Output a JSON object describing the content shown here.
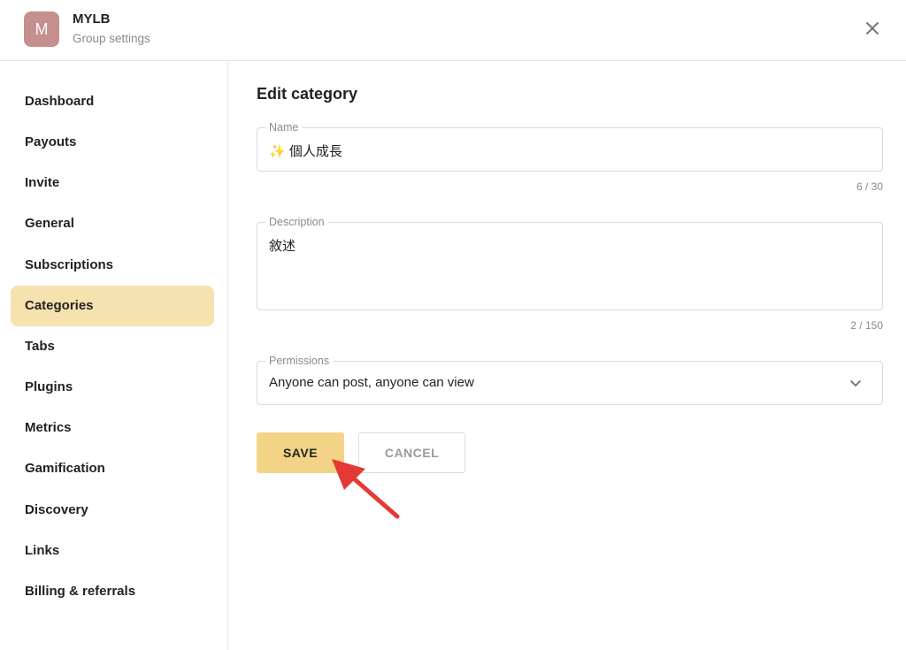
{
  "header": {
    "avatar_letter": "M",
    "group_name": "MYLB",
    "subtitle": "Group settings",
    "close_icon": "close-icon"
  },
  "sidebar": {
    "items": [
      {
        "label": "Dashboard",
        "active": false
      },
      {
        "label": "Payouts",
        "active": false
      },
      {
        "label": "Invite",
        "active": false
      },
      {
        "label": "General",
        "active": false
      },
      {
        "label": "Subscriptions",
        "active": false
      },
      {
        "label": "Categories",
        "active": true
      },
      {
        "label": "Tabs",
        "active": false
      },
      {
        "label": "Plugins",
        "active": false
      },
      {
        "label": "Metrics",
        "active": false
      },
      {
        "label": "Gamification",
        "active": false
      },
      {
        "label": "Discovery",
        "active": false
      },
      {
        "label": "Links",
        "active": false
      },
      {
        "label": "Billing & referrals",
        "active": false
      }
    ]
  },
  "main": {
    "title": "Edit category",
    "name_field": {
      "label": "Name",
      "value": "✨ 個人成長",
      "counter": "6 / 30"
    },
    "description_field": {
      "label": "Description",
      "value": "敘述",
      "counter": "2 / 150"
    },
    "permissions_field": {
      "label": "Permissions",
      "value": "Anyone can post, anyone can view",
      "icon": "chevron-down-icon"
    },
    "save_label": "SAVE",
    "cancel_label": "CANCEL"
  },
  "colors": {
    "avatar": "#c48f8c",
    "active_nav": "#f6e2ae",
    "save_button": "#f3d487",
    "annotation_arrow": "#e53935"
  }
}
